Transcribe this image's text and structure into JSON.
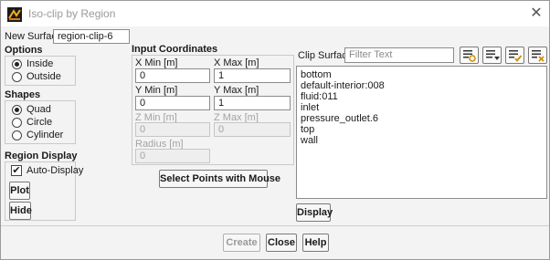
{
  "window": {
    "title": "Iso-clip by Region"
  },
  "new_surface": {
    "label": "New Surface",
    "value": "region-clip-6"
  },
  "options": {
    "title": "Options",
    "items": [
      {
        "label": "Inside",
        "selected": true
      },
      {
        "label": "Outside",
        "selected": false
      }
    ]
  },
  "shapes": {
    "title": "Shapes",
    "items": [
      {
        "label": "Quad",
        "selected": true
      },
      {
        "label": "Circle",
        "selected": false
      },
      {
        "label": "Cylinder",
        "selected": false
      }
    ]
  },
  "region_display": {
    "title": "Region Display",
    "auto_display": {
      "label": "Auto-Display",
      "checked": true
    },
    "plot_label": "Plot",
    "hide_label": "Hide"
  },
  "input_coordinates": {
    "title": "Input Coordinates",
    "x_min": {
      "label": "X Min [m]",
      "value": "0"
    },
    "x_max": {
      "label": "X Max [m]",
      "value": "1"
    },
    "y_min": {
      "label": "Y Min [m]",
      "value": "0"
    },
    "y_max": {
      "label": "Y Max [m]",
      "value": "1"
    },
    "z_min": {
      "label": "Z Min [m]",
      "value": "0"
    },
    "z_max": {
      "label": "Z Max [m]",
      "value": "0"
    },
    "radius": {
      "label": "Radius [m]",
      "value": "0"
    },
    "select_points_label": "Select Points with Mouse"
  },
  "clip_surface": {
    "label": "Clip Surface",
    "filter_placeholder": "Filter Text",
    "items": [
      "bottom",
      "default-interior:008",
      "fluid:011",
      "inlet",
      "pressure_outlet.6",
      "top",
      "wall"
    ],
    "display_label": "Display"
  },
  "footer": {
    "create_label": "Create",
    "close_label": "Close",
    "help_label": "Help"
  }
}
